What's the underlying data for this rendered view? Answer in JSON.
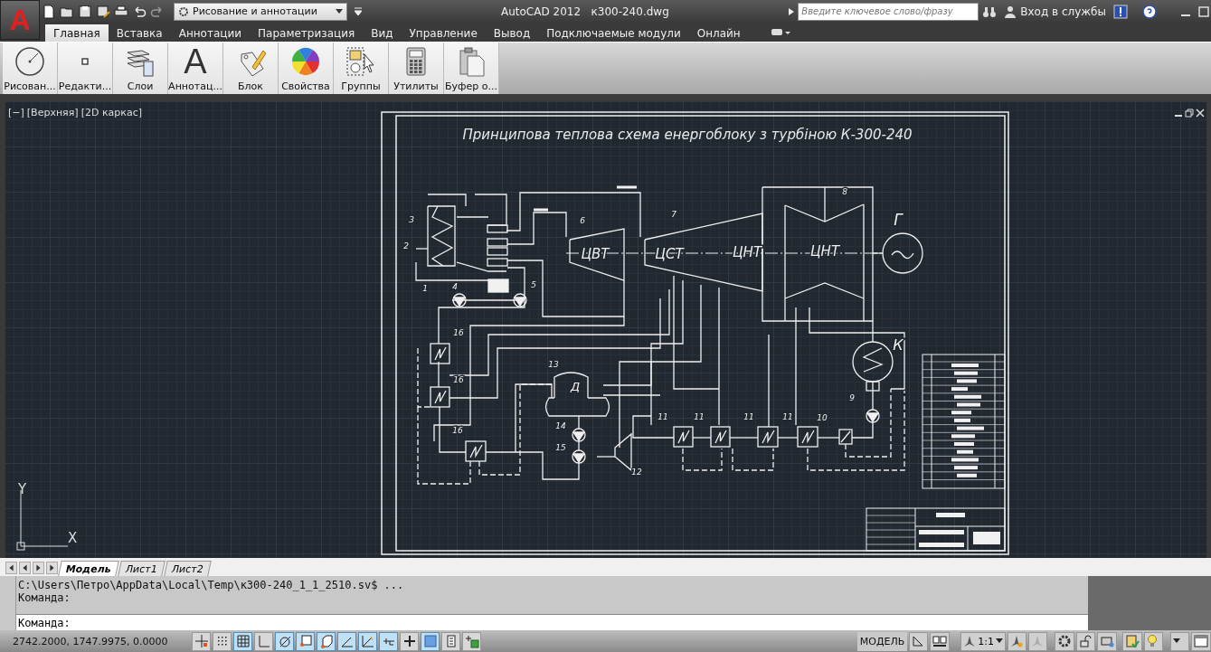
{
  "app_button": {
    "label": "A"
  },
  "workspace": "Рисование и аннотации",
  "title": {
    "app": "AutoCAD 2012",
    "file": "к300-240.dwg"
  },
  "search": {
    "placeholder": "Введите ключевое слово/фразу"
  },
  "sign_in": "Вход в службы",
  "tabs": [
    {
      "label": "Главная",
      "selected": true
    },
    {
      "label": "Вставка",
      "selected": false
    },
    {
      "label": "Аннотации",
      "selected": false
    },
    {
      "label": "Параметризация",
      "selected": false
    },
    {
      "label": "Вид",
      "selected": false
    },
    {
      "label": "Управление",
      "selected": false
    },
    {
      "label": "Вывод",
      "selected": false
    },
    {
      "label": "Подключаемые модули",
      "selected": false
    },
    {
      "label": "Онлайн",
      "selected": false
    }
  ],
  "ribbon_panels": [
    {
      "kind": "draw",
      "label": "Рисован..."
    },
    {
      "kind": "modify",
      "label": "Редакти..."
    },
    {
      "kind": "layers",
      "label": "Слои"
    },
    {
      "kind": "annotation",
      "label": "Аннотац...",
      "glyph": "A"
    },
    {
      "kind": "block",
      "label": "Блок"
    },
    {
      "kind": "properties",
      "label": "Свойства"
    },
    {
      "kind": "groups",
      "label": "Группы"
    },
    {
      "kind": "utilities",
      "label": "Утилиты"
    },
    {
      "kind": "clipboard",
      "label": "Буфер о..."
    }
  ],
  "viewport": {
    "controls": [
      "[−]",
      "[Верхняя]",
      "[2D каркас]"
    ],
    "ucs": {
      "x": "X",
      "y": "Y"
    }
  },
  "drawing": {
    "title": "Принципова теплова схема енергоблоку з турбіною К-300-240",
    "labels": [
      "3",
      "2",
      "1",
      "4",
      "5",
      "6",
      "7",
      "8",
      "Г",
      "ЦВТ",
      "ЦСТ",
      "ЦНТ",
      "ЦНТ",
      "К",
      "16",
      "16",
      "16",
      "13",
      "Д",
      "14",
      "15",
      "12",
      "11",
      "11",
      "11",
      "11",
      "10",
      "9"
    ]
  },
  "layout_tabs": [
    {
      "label": "Модель",
      "selected": true
    },
    {
      "label": "Лист1",
      "selected": false
    },
    {
      "label": "Лист2",
      "selected": false
    }
  ],
  "command_history": [
    "C:\\Users\\Петро\\AppData\\Local\\Temp\\к300-240_1_1_2510.sv$ ...",
    "Команда:"
  ],
  "command_prompt": "Команда:",
  "status_bar": {
    "coordinates": "2742.2000, 1747.9975, 0.0000",
    "toggles": [
      {
        "kind": "snap",
        "on": false
      },
      {
        "kind": "dots",
        "on": false
      },
      {
        "kind": "grid",
        "on": true
      },
      {
        "kind": "ortho",
        "on": false
      },
      {
        "kind": "polar",
        "on": true
      },
      {
        "kind": "osnap",
        "on": true
      },
      {
        "kind": "osnap3d",
        "on": true
      },
      {
        "kind": "otrack",
        "on": true
      },
      {
        "kind": "ducs",
        "on": true
      },
      {
        "kind": "dyn",
        "on": true
      },
      {
        "kind": "lwt",
        "on": false
      },
      {
        "kind": "transparency",
        "on": true
      },
      {
        "kind": "qp",
        "on": false
      },
      {
        "kind": "sc",
        "on": false
      }
    ],
    "space": "МОДЕЛЬ",
    "scale": "1:1"
  }
}
